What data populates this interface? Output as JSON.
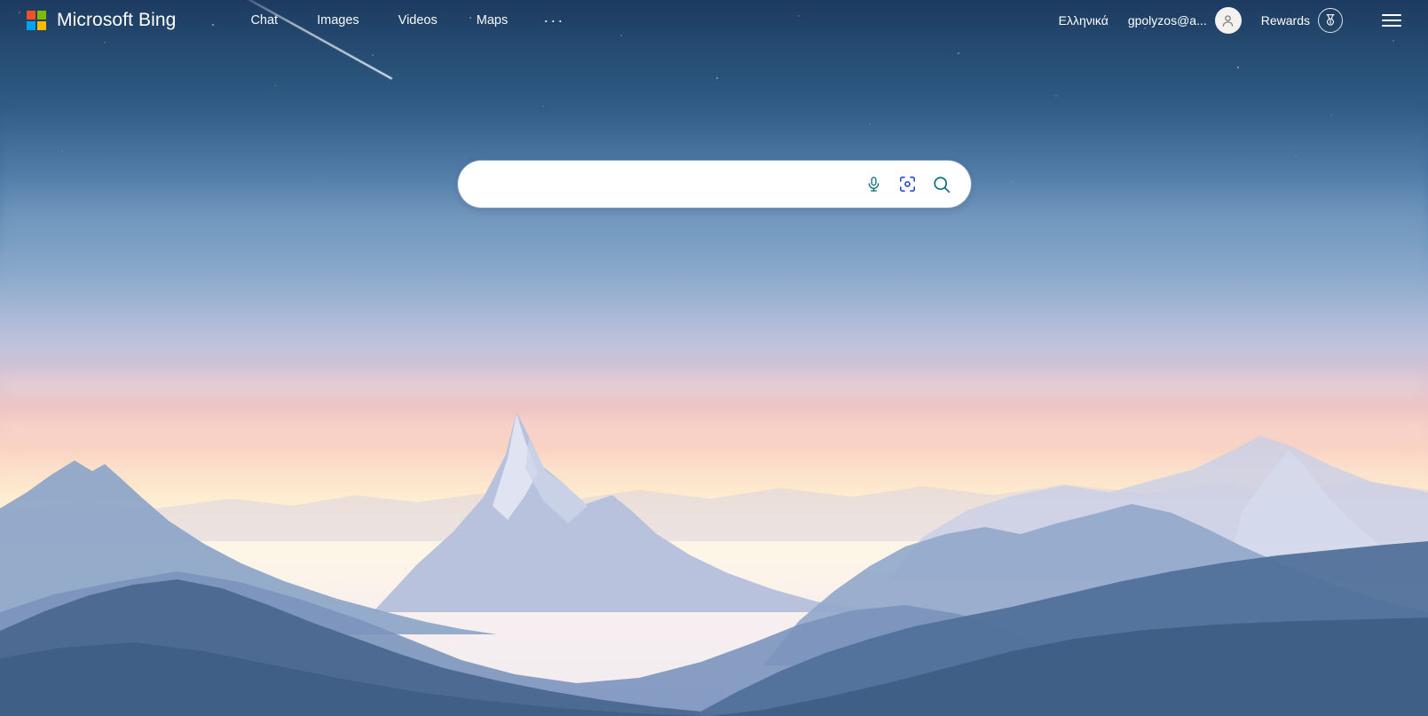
{
  "header": {
    "brand": {
      "text": "Microsoft Bing",
      "logo_icon": "microsoft-logo-icon"
    },
    "nav": [
      {
        "label": "Chat",
        "name": "nav-chat"
      },
      {
        "label": "Images",
        "name": "nav-images"
      },
      {
        "label": "Videos",
        "name": "nav-videos"
      },
      {
        "label": "Maps",
        "name": "nav-maps"
      }
    ],
    "more_label": "···",
    "language": "Ελληνικά",
    "account": {
      "name": "gpolyzos@a...",
      "avatar_icon": "person-avatar-icon"
    },
    "rewards": {
      "label": "Rewards",
      "icon": "medal-icon"
    },
    "menu_icon": "hamburger-menu-icon"
  },
  "search": {
    "value": "",
    "placeholder": "",
    "mic_icon": "microphone-icon",
    "visual_icon": "visual-search-camera-icon",
    "submit_icon": "search-magnifier-icon"
  },
  "colors": {
    "ms_red": "#f25022",
    "ms_green": "#7fba00",
    "ms_blue": "#00a4ef",
    "ms_yellow": "#ffb900",
    "mic_teal": "#0f6e7d",
    "visual_blue": "#2b4ec4",
    "search_teal": "#0f6e7d",
    "header_text": "#ffffff",
    "sky_top": "#1d3a5f",
    "sky_pink": "#f7cfc3",
    "mountain_dark": "#3c5a7d"
  },
  "background": {
    "scene": "mountain-sunset-landscape",
    "description": "Layered blue mountain ridges under a pink and peach sunset sky with stars and a meteor streak"
  }
}
